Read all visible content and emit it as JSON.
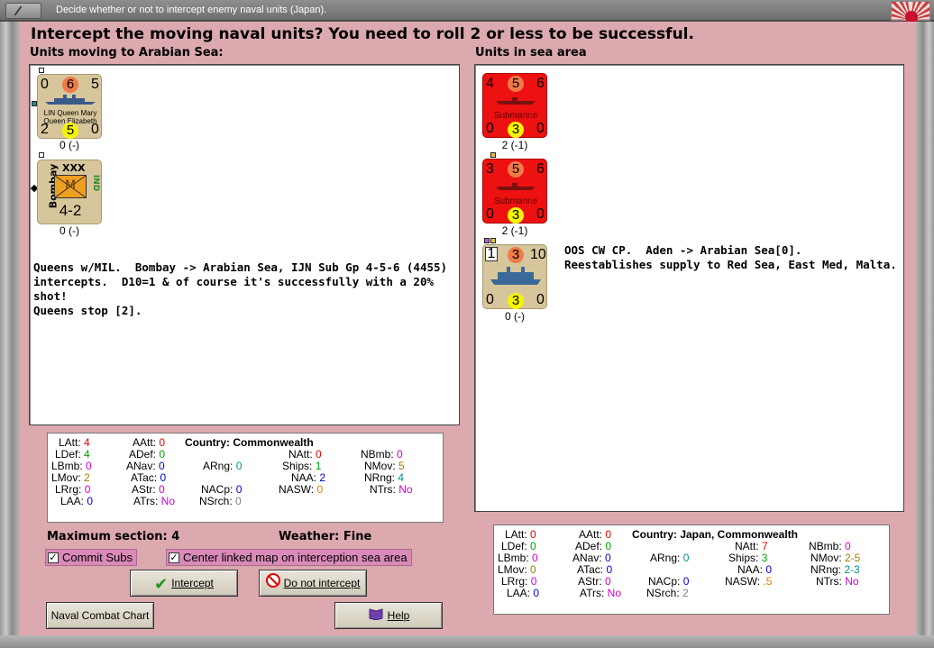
{
  "window": {
    "title": "Decide whether or not to intercept enemy naval units (Japan)."
  },
  "heading": "Intercept the moving naval units?  You need to roll 2 or less to be successful.",
  "left": {
    "label": "Units moving to Arabian Sea:",
    "units": [
      {
        "type": "ship",
        "top_left": "0",
        "top_mid": "6",
        "top_right": "5",
        "name1": "LIN Queen Mary",
        "name2": "Queen Elizabeth",
        "bot_left": "2",
        "bot_mid": "5",
        "bot_right": "0",
        "caption": "0 (-)"
      },
      {
        "type": "army",
        "name": "Bombay",
        "size": "XXX",
        "branch": "M",
        "nation": "IND",
        "strength": "4-2",
        "caption": "0 (-)"
      }
    ],
    "notes": "Queens w/MIL.  Bombay -> Arabian Sea, IJN Sub Gp 4-5-6 (4455)\nintercepts.  D10=1 & of course it's successfully with a 20% shot!\nQueens stop [2]."
  },
  "right": {
    "label": "Units in sea area",
    "units": [
      {
        "type": "sub",
        "top_left": "4",
        "top_mid": "5",
        "top_right": "6",
        "name": "Submarine",
        "bot_left": "0",
        "bot_mid": "3",
        "bot_right": "0",
        "caption": "2 (-1)"
      },
      {
        "type": "sub",
        "top_left": "3",
        "top_mid": "5",
        "top_right": "6",
        "name": "Submarine",
        "bot_left": "0",
        "bot_mid": "3",
        "bot_right": "0",
        "caption": "2 (-1)"
      },
      {
        "type": "cp",
        "top_left": "1",
        "top_mid": "3",
        "top_right": "10",
        "bot_left": "0",
        "bot_mid": "3",
        "bot_right": "0",
        "caption": "0 (-)"
      }
    ],
    "notes": "OOS CW CP.  Aden -> Arabian Sea[0].\nReestablishes supply to Red Sea, East Med, Malta."
  },
  "stats_left": {
    "country": "Country: Commonwealth",
    "LAtt": "4",
    "LDef": "4",
    "LBmb": "0",
    "LMov": "2",
    "LRrg": "0",
    "LAA": "0",
    "AAtt": "0",
    "ADef": "0",
    "ANav": "0",
    "ATac": "0",
    "AStr": "0",
    "ATrs": "No",
    "ARng": "0",
    "NACp": "0",
    "NSrch": "0",
    "NAtt": "0",
    "Ships": "1",
    "NAA": "2",
    "NASW": "0",
    "NBmb": "0",
    "NMov": "5",
    "NRng": "4",
    "NTrs": "No"
  },
  "stats_right": {
    "country": "Country: Japan, Commonwealth",
    "LAtt": "0",
    "LDef": "0",
    "LBmb": "0",
    "LMov": "0",
    "LRrg": "0",
    "LAA": "0",
    "AAtt": "0",
    "ADef": "0",
    "ANav": "0",
    "ATac": "0",
    "AStr": "0",
    "ATrs": "No",
    "ARng": "0",
    "NACp": "0",
    "NSrch": "2",
    "NAtt": "7",
    "Ships": "3",
    "NAA": "0",
    "NASW": ".5",
    "NBmb": "0",
    "NMov": "2-5",
    "NRng": "2-3",
    "NTrs": "No"
  },
  "info": {
    "max_section": "Maximum section: 4",
    "weather": "Weather:  Fine"
  },
  "checks": {
    "commit_subs": "Commit Subs",
    "center_map": "Center linked map on interception sea area"
  },
  "buttons": {
    "intercept": "Intercept",
    "no_intercept": "Do not intercept",
    "naval_chart": "Naval Combat Chart",
    "help": "Help"
  }
}
